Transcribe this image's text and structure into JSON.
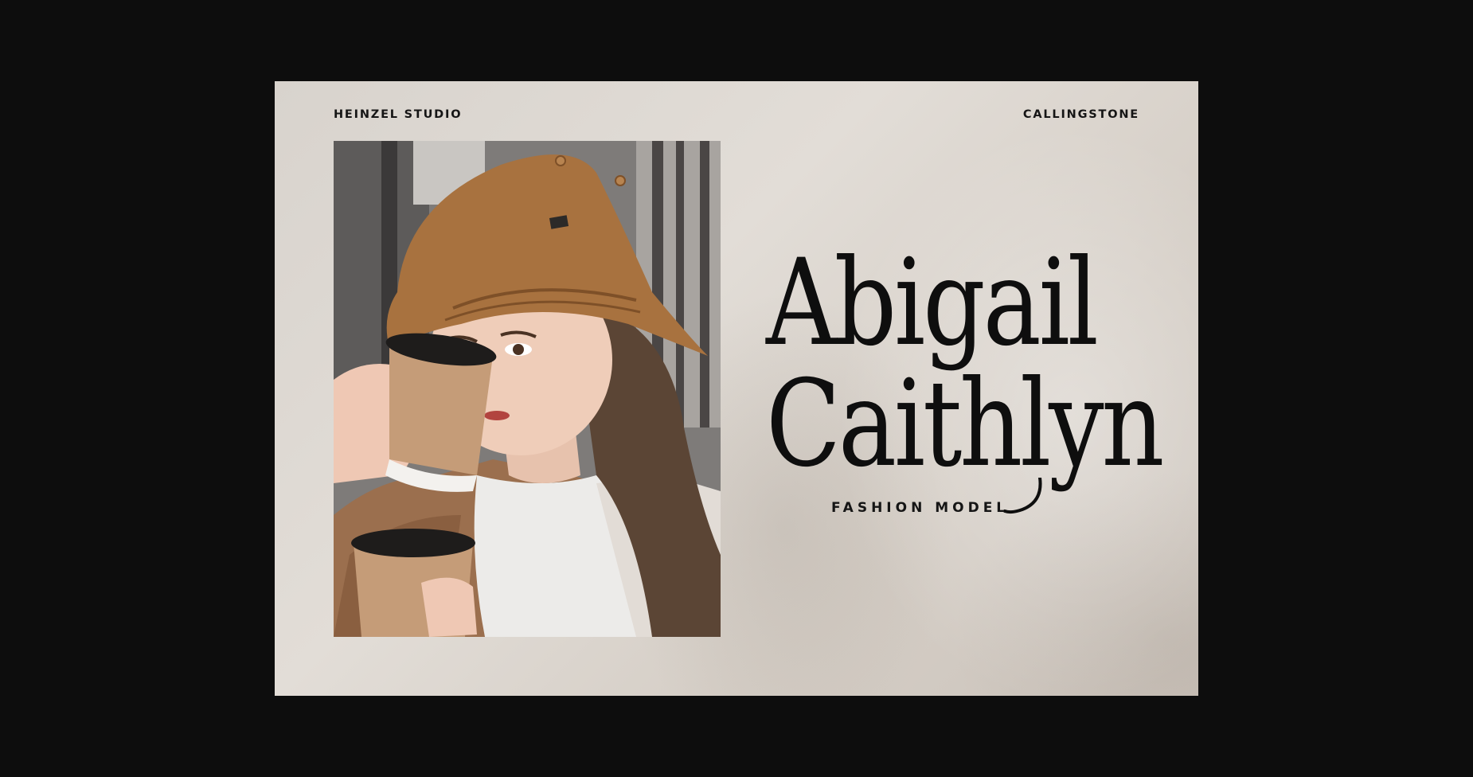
{
  "header": {
    "left_brand": "HEINZEL STUDIO",
    "right_brand": "CALLINGSTONE"
  },
  "hero": {
    "first_name": "Abigail",
    "last_name": "Caithlyn",
    "role": "FASHION MODEL"
  },
  "photo": {
    "subject": "woman in tan bucket hat drinking from a paper coffee cup"
  },
  "colors": {
    "page_background": "#0d0d0d",
    "card_background": "#ddd8d2",
    "text": "#0e0e0e",
    "hat": "#a8723f",
    "jacket": "#9b6f4e"
  }
}
